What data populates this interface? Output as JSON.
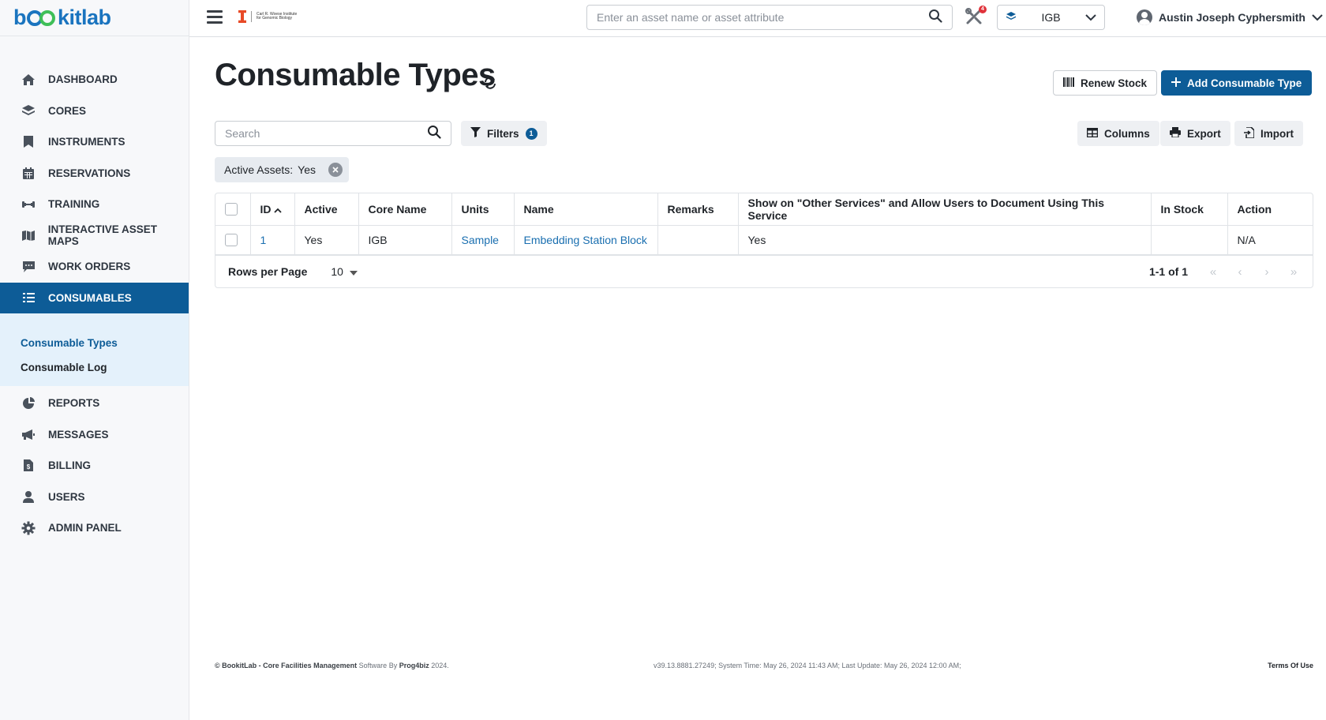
{
  "brand": {
    "logo_text_left": "b",
    "logo_text_right": "kitlab"
  },
  "institute": {
    "line1": "Carl R. Woese Institute",
    "line2": "for Genomic Biology"
  },
  "sidebar": {
    "items": [
      {
        "label": "DASHBOARD",
        "icon": "home-icon"
      },
      {
        "label": "CORES",
        "icon": "layers-icon"
      },
      {
        "label": "INSTRUMENTS",
        "icon": "bookmark-icon"
      },
      {
        "label": "RESERVATIONS",
        "icon": "calendar-icon"
      },
      {
        "label": "TRAINING",
        "icon": "dumbbell-icon"
      },
      {
        "label": "INTERACTIVE ASSET MAPS",
        "icon": "map-icon"
      },
      {
        "label": "WORK ORDERS",
        "icon": "comment-icon"
      },
      {
        "label": "CONSUMABLES",
        "icon": "list-icon",
        "active": true
      }
    ],
    "sub_items": [
      {
        "label": "Consumable Types",
        "active": true
      },
      {
        "label": "Consumable Log"
      }
    ],
    "items_after": [
      {
        "label": "REPORTS",
        "icon": "pie-chart-icon"
      },
      {
        "label": "MESSAGES",
        "icon": "megaphone-icon"
      },
      {
        "label": "BILLING",
        "icon": "invoice-icon"
      },
      {
        "label": "USERS",
        "icon": "user-icon"
      },
      {
        "label": "ADMIN PANEL",
        "icon": "gear-icon"
      }
    ]
  },
  "topbar": {
    "search_placeholder": "Enter an asset name or asset attribute",
    "tools_badge": "4",
    "core_value": "IGB",
    "user_name": "Austin Joseph Cyphersmith"
  },
  "page": {
    "title": "Consumable Types",
    "renew_label": "Renew Stock",
    "add_label": "Add Consumable Type",
    "search_placeholder": "Search",
    "filters_label": "Filters",
    "filters_count": "1",
    "columns_label": "Columns",
    "export_label": "Export",
    "import_label": "Import",
    "chip_key": "Active Assets:",
    "chip_value": "Yes"
  },
  "table": {
    "headers": [
      "ID",
      "Active",
      "Core Name",
      "Units",
      "Name",
      "Remarks",
      "Show on \"Other Services\" and Allow Users to Document Using This Service",
      "In Stock",
      "Action"
    ],
    "rows": [
      {
        "id": "1",
        "active": "Yes",
        "core": "IGB",
        "units": "Sample",
        "name": "Embedding Station Block",
        "remarks": "",
        "show": "Yes",
        "in_stock": "",
        "action": "N/A"
      }
    ],
    "rows_per_page_label": "Rows per Page",
    "rows_per_page": "10",
    "range": "1-1 of 1"
  },
  "footer": {
    "copyright": "© BookitLab - Core Facilities Management",
    "software_by": " Software By ",
    "vendor": "Prog4biz",
    "year": " 2024.",
    "version": "v39.13.8881.27249; System Time: May 26, 2024 11:43 AM; Last Update: May 26, 2024 12:00 AM;",
    "terms": "Terms Of Use"
  },
  "colors": {
    "primary": "#0d5c97",
    "link": "#1a6fb0",
    "logo_blue": "#1a74bf",
    "logo_green": "#3fbf58"
  }
}
